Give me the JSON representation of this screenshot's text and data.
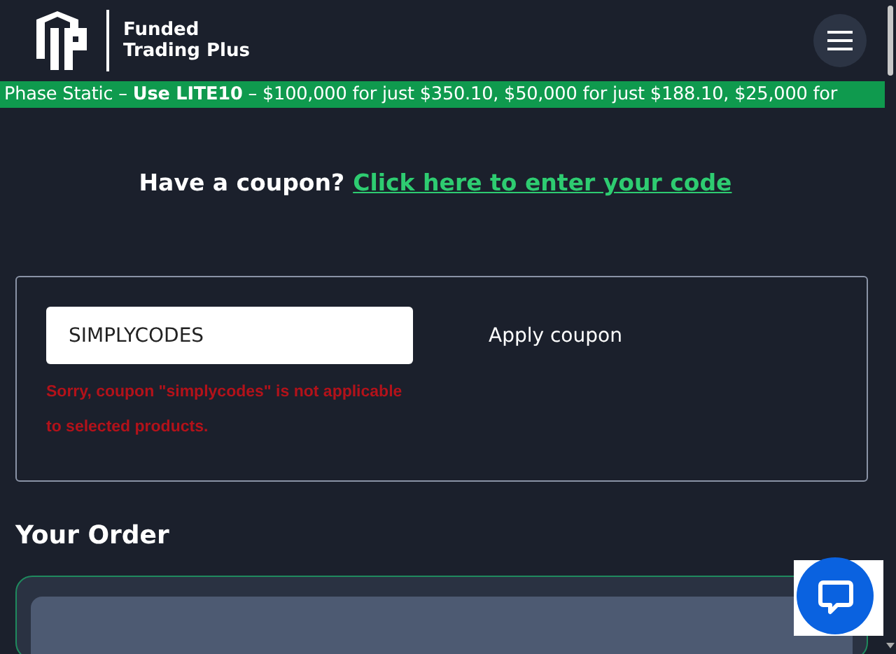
{
  "header": {
    "brand": [
      "Funded",
      "Trading Plus"
    ]
  },
  "promo_banner": {
    "text": "Phase Static – **Use LITE10** – $100,000 for just $350.10, $50,000 for just $188.10, $25,000 for"
  },
  "coupon_prompt": {
    "text": "Have a coupon?",
    "link": "Click here to enter your code"
  },
  "coupon_form": {
    "value": "SIMPLYCODES",
    "button": "Apply coupon",
    "error": "Sorry, coupon \"simplycodes\" is not applicable to selected products."
  },
  "order": {
    "title": "Your Order"
  },
  "chat_widget": {
    "kind": "chat"
  }
}
